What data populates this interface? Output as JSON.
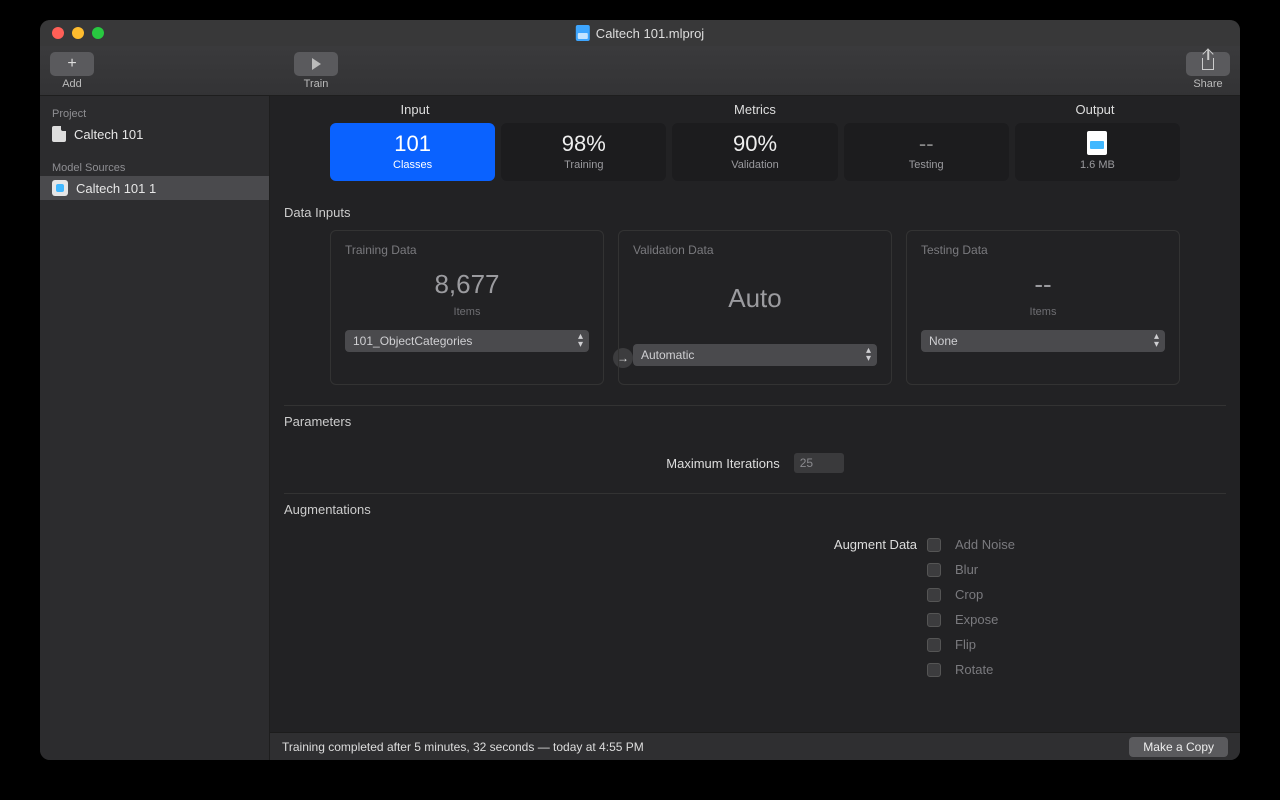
{
  "titlebar": {
    "filename": "Caltech 101.mlproj"
  },
  "toolbar": {
    "add_label": "Add",
    "train_label": "Train",
    "share_label": "Share"
  },
  "sidebar": {
    "project_header": "Project",
    "project_name": "Caltech 101",
    "sources_header": "Model Sources",
    "source_name": "Caltech 101 1"
  },
  "headers": {
    "input": "Input",
    "metrics": "Metrics",
    "output": "Output"
  },
  "metrics": {
    "input": {
      "value": "101",
      "label": "Classes"
    },
    "training": {
      "value": "98%",
      "label": "Training"
    },
    "validation": {
      "value": "90%",
      "label": "Validation"
    },
    "testing": {
      "value": "--",
      "label": "Testing"
    },
    "output": {
      "value": "1.6 MB"
    }
  },
  "data_inputs": {
    "section": "Data Inputs",
    "training": {
      "title": "Training Data",
      "value": "8,677",
      "sub": "Items",
      "select": "101_ObjectCategories"
    },
    "validation": {
      "title": "Validation Data",
      "value": "Auto",
      "select": "Automatic"
    },
    "testing": {
      "title": "Testing Data",
      "value": "--",
      "sub": "Items",
      "select": "None"
    }
  },
  "parameters": {
    "section": "Parameters",
    "max_iter_label": "Maximum Iterations",
    "max_iter_value": "25"
  },
  "augmentations": {
    "section": "Augmentations",
    "label": "Augment Data",
    "options": {
      "noise": "Add Noise",
      "blur": "Blur",
      "crop": "Crop",
      "expose": "Expose",
      "flip": "Flip",
      "rotate": "Rotate"
    }
  },
  "status": {
    "text": "Training completed after 5 minutes, 32 seconds — today at 4:55 PM",
    "copy_label": "Make a Copy"
  }
}
